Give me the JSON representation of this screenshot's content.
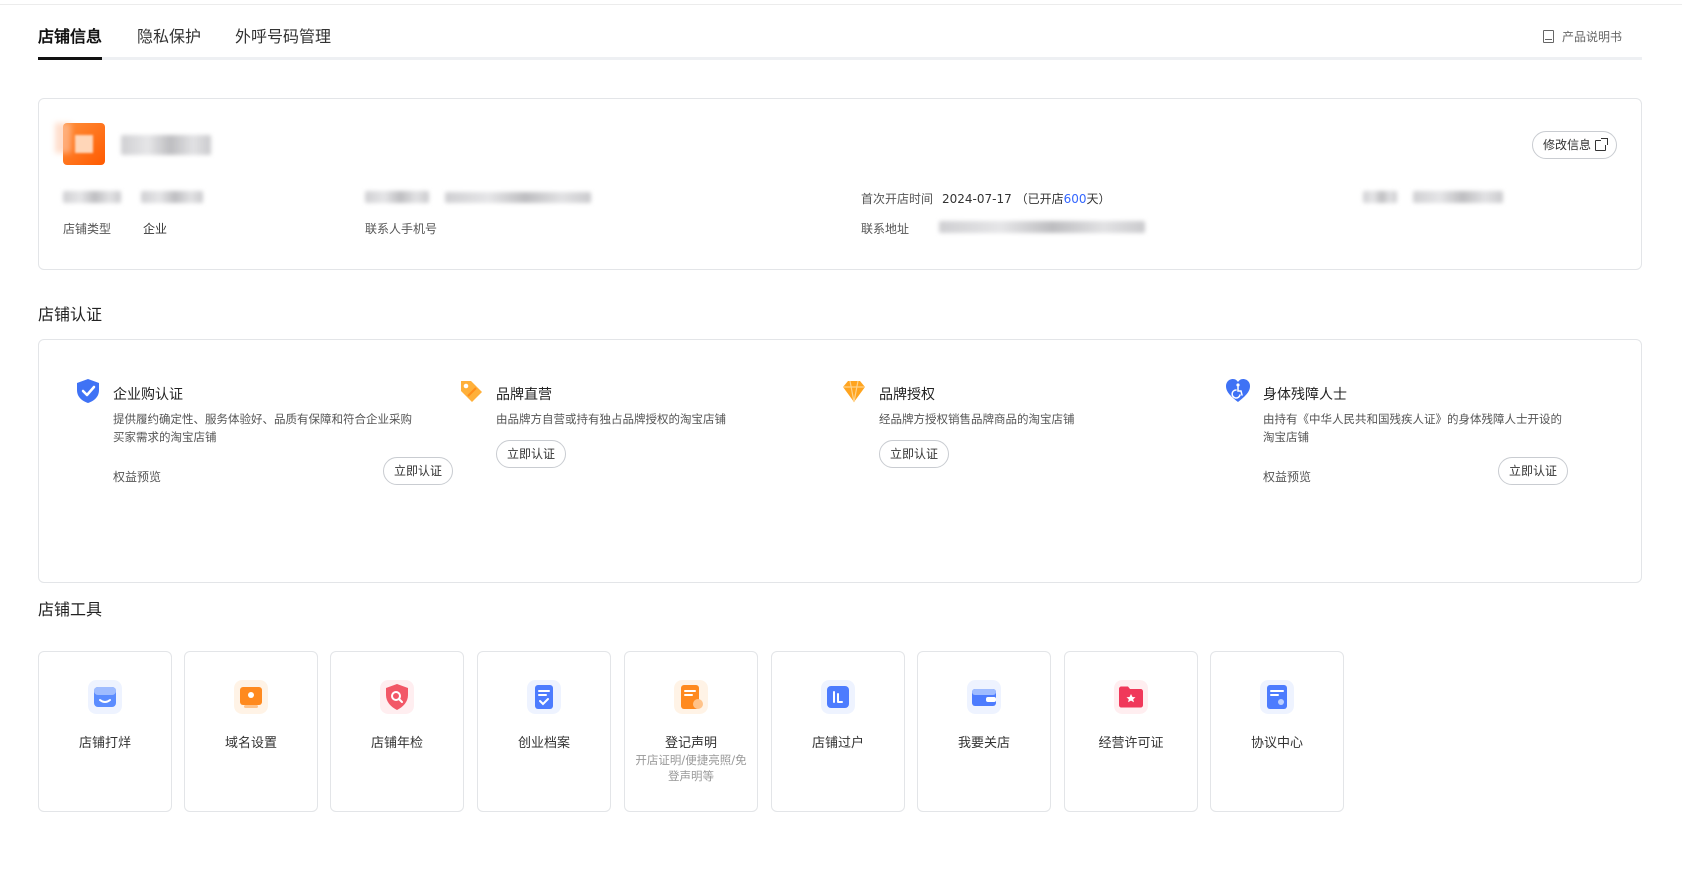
{
  "tabs": [
    "店铺信息",
    "隐私保护",
    "外呼号码管理"
  ],
  "manual_label": "产品说明书",
  "info": {
    "edit_button": "修改信息",
    "shop_type_label": "店铺类型",
    "shop_type_value": "企业",
    "contact_phone_label": "联系人手机号",
    "open_time_label": "首次开店时间",
    "open_date": "2024-07-17",
    "open_prefix": "（已开店",
    "open_days": "600",
    "open_suffix": "天）",
    "address_label": "联系地址"
  },
  "cert_section_title": "店铺认证",
  "certs": [
    {
      "title": "企业购认证",
      "desc": "提供履约确定性、服务体验好、品质有保障和符合企业采购买家需求的淘宝店铺",
      "perk": "权益预览",
      "button": "立即认证"
    },
    {
      "title": "品牌直营",
      "desc": "由品牌方自营或持有独占品牌授权的淘宝店铺",
      "button": "立即认证"
    },
    {
      "title": "品牌授权",
      "desc": "经品牌方授权销售品牌商品的淘宝店铺",
      "button": "立即认证"
    },
    {
      "title": "身体残障人士",
      "desc": "由持有《中华人民共和国残疾人证》的身体残障人士开设的淘宝店铺",
      "perk": "权益预览",
      "button": "立即认证"
    }
  ],
  "tools_section_title": "店铺工具",
  "tools": [
    {
      "label": "店铺打烊",
      "icon": "store-closed-icon",
      "color": "#4d7cfe"
    },
    {
      "label": "域名设置",
      "icon": "domain-icon",
      "color": "#ff8a1f"
    },
    {
      "label": "店铺年检",
      "icon": "shield-search-icon",
      "color": "#f25767"
    },
    {
      "label": "创业档案",
      "icon": "archive-icon",
      "color": "#4d7cfe"
    },
    {
      "label": "登记声明",
      "sub": "开店证明/便捷亮照/免登声明等",
      "icon": "document-icon",
      "color": "#ff8a1f"
    },
    {
      "label": "店铺过户",
      "icon": "transfer-icon",
      "color": "#4d7cfe"
    },
    {
      "label": "我要关店",
      "icon": "wallet-icon",
      "color": "#4d7cfe"
    },
    {
      "label": "经营许可证",
      "icon": "license-folder-icon",
      "color": "#f0385a"
    },
    {
      "label": "协议中心",
      "icon": "agreement-icon",
      "color": "#4d7cfe"
    }
  ]
}
